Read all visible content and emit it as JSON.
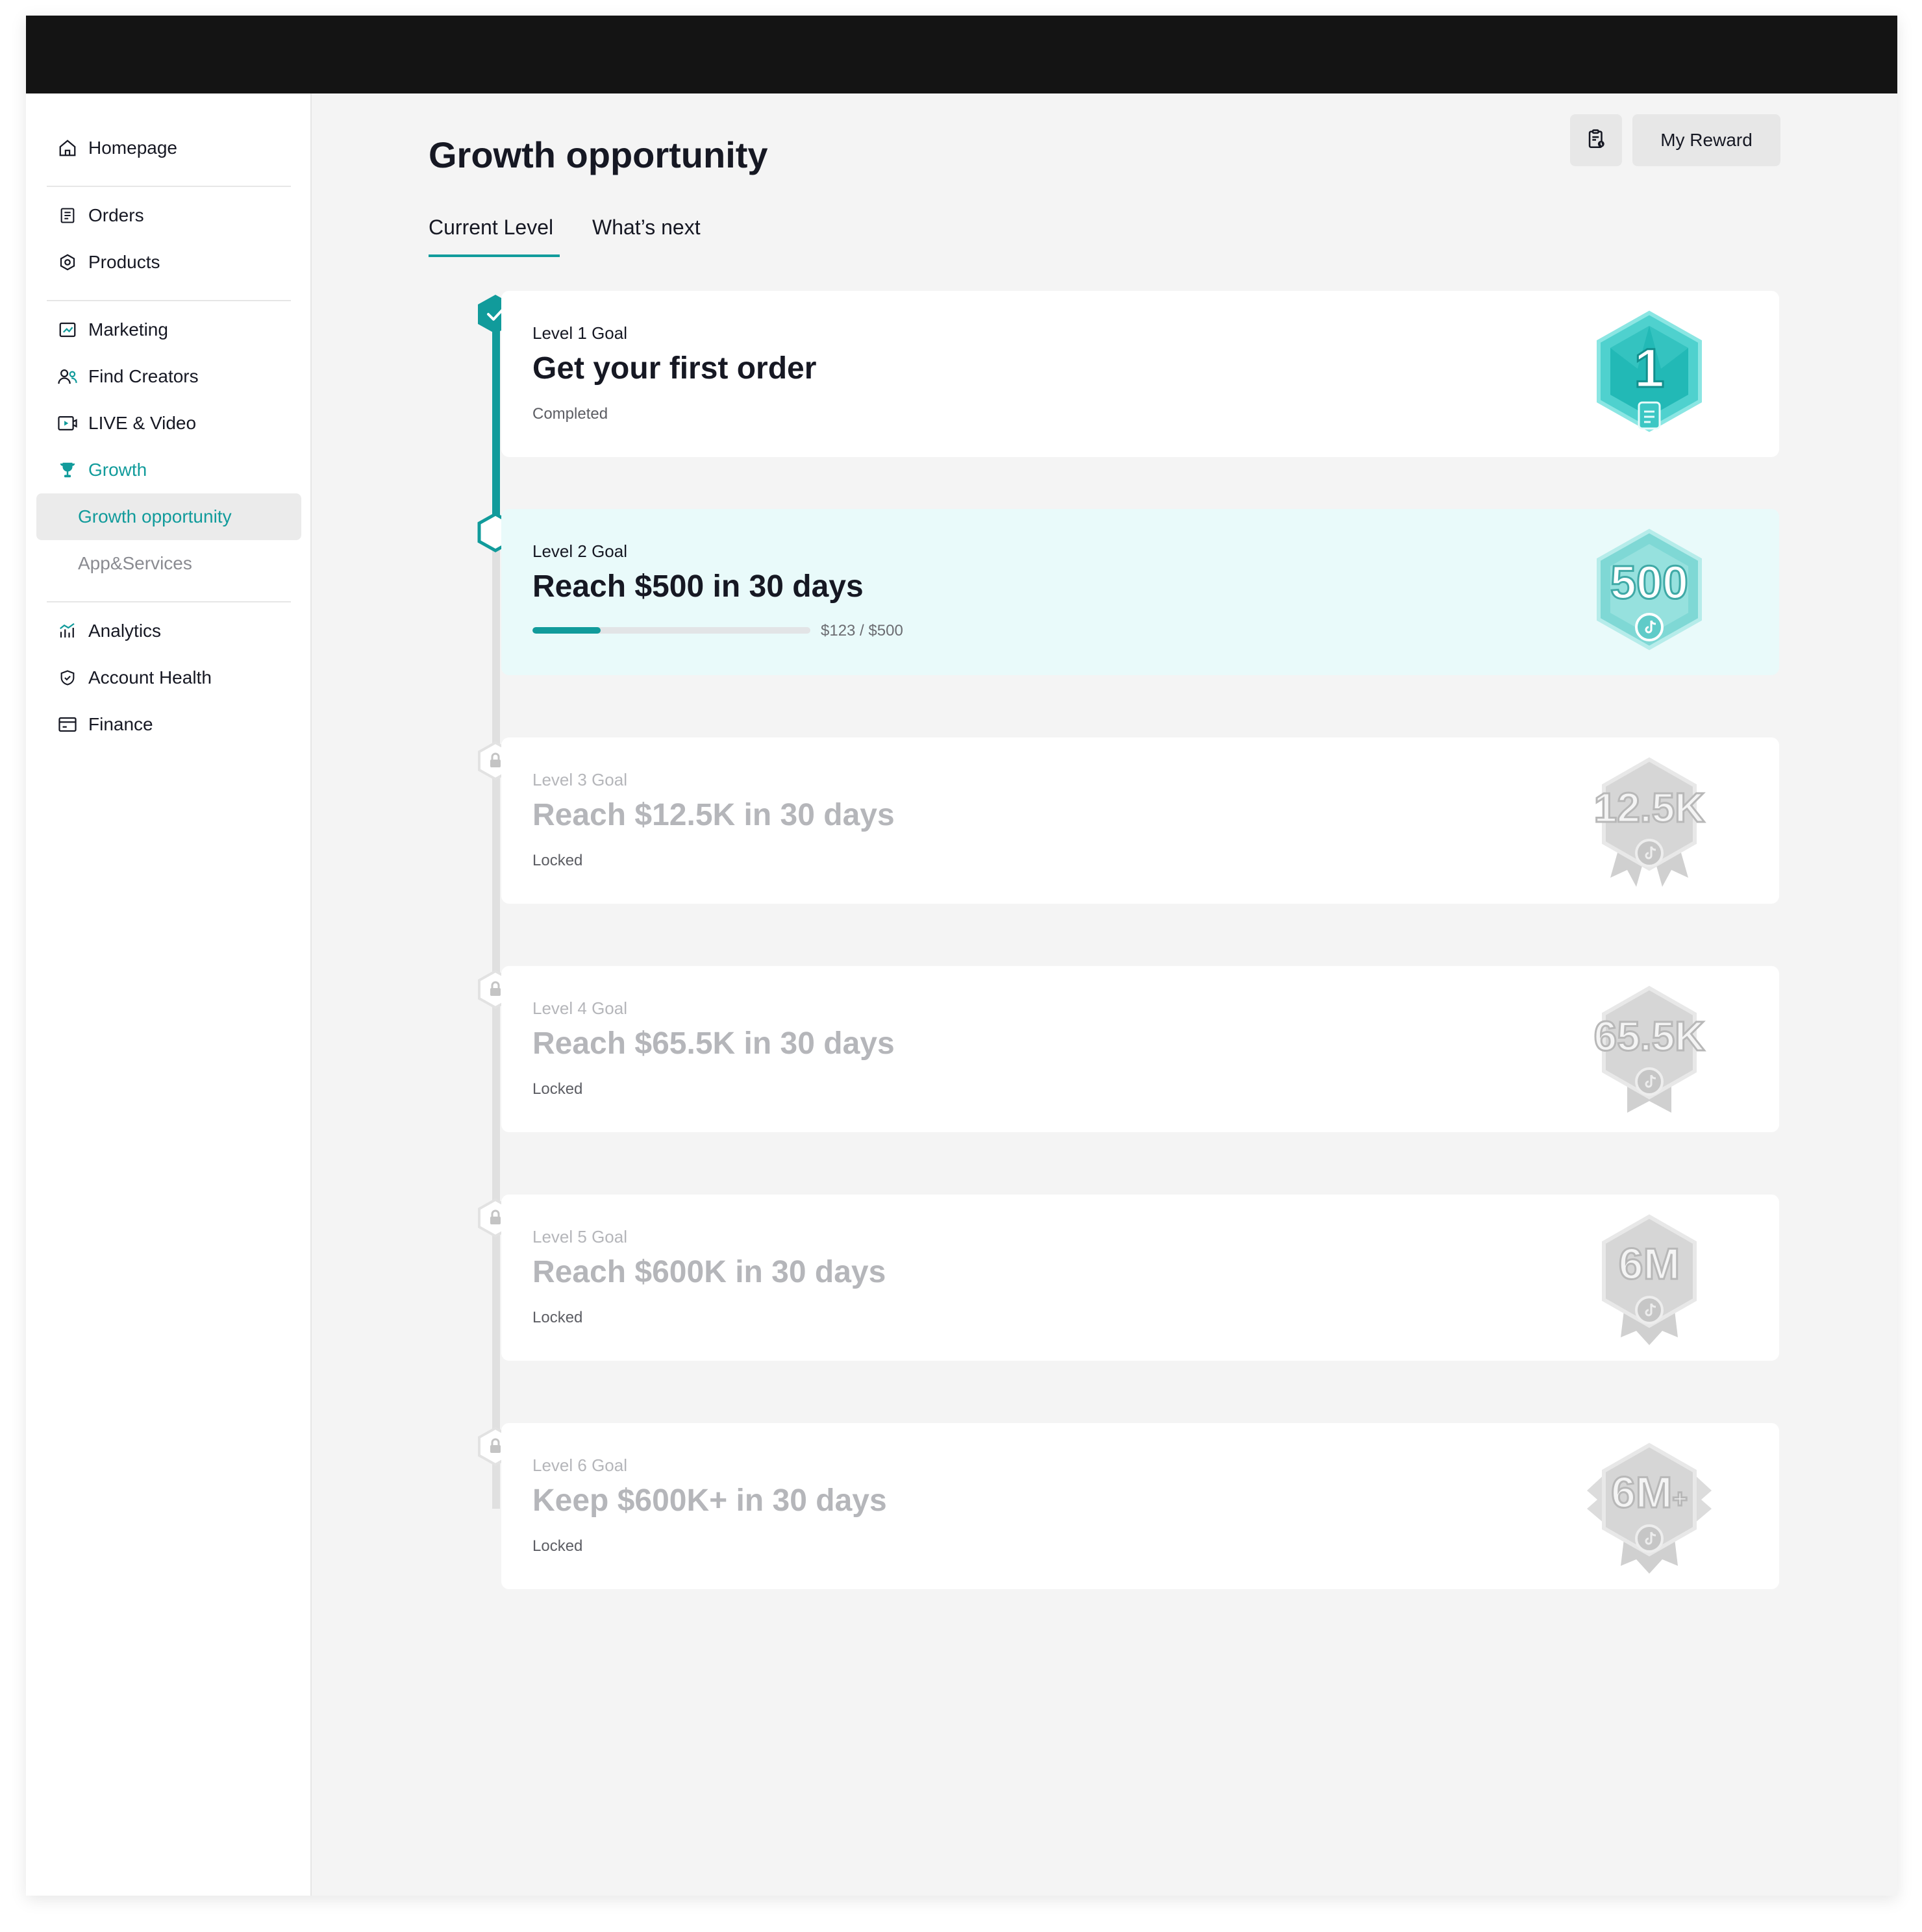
{
  "sidebar": {
    "items": [
      {
        "label": "Homepage",
        "icon": "home-icon"
      },
      {
        "label": "Orders",
        "icon": "orders-icon"
      },
      {
        "label": "Products",
        "icon": "products-icon"
      },
      {
        "label": "Marketing",
        "icon": "marketing-icon"
      },
      {
        "label": "Find Creators",
        "icon": "creators-icon"
      },
      {
        "label": "LIVE & Video",
        "icon": "live-video-icon"
      },
      {
        "label": "Growth",
        "icon": "trophy-icon",
        "expanded": true
      },
      {
        "label": "Growth opportunity",
        "selected": true
      },
      {
        "label": "App&Services"
      },
      {
        "label": "Analytics",
        "icon": "analytics-icon"
      },
      {
        "label": "Account Health",
        "icon": "shield-icon"
      },
      {
        "label": "Finance",
        "icon": "finance-icon"
      }
    ]
  },
  "header": {
    "title": "Growth opportunity",
    "icon_button": "clipboard-icon",
    "reward_label": "My Reward"
  },
  "tabs": [
    {
      "label": "Current Level",
      "active": true
    },
    {
      "label": "What’s next"
    }
  ],
  "levels": [
    {
      "level_label": "Level 1 Goal",
      "title": "Get your first order",
      "status": "Completed",
      "badge": "1",
      "state": "completed"
    },
    {
      "level_label": "Level 2 Goal",
      "title": "Reach $500 in 30 days",
      "progress_text": "$123 / $500",
      "progress": 0.246,
      "badge": "500",
      "state": "current"
    },
    {
      "level_label": "Level 3 Goal",
      "title": "Reach $12.5K in 30 days",
      "status": "Locked",
      "badge": "12.5K",
      "state": "locked"
    },
    {
      "level_label": "Level 4 Goal",
      "title": "Reach $65.5K in 30 days",
      "status": "Locked",
      "badge": "65.5K",
      "state": "locked"
    },
    {
      "level_label": "Level 5 Goal",
      "title": "Reach $600K in 30 days",
      "status": "Locked",
      "badge": "6M",
      "state": "locked"
    },
    {
      "level_label": "Level 6 Goal",
      "title": "Keep $600K+ in 30 days",
      "status": "Locked",
      "badge": "6M",
      "badge_suffix": "+",
      "state": "locked"
    }
  ],
  "colors": {
    "accent": "#119b9b",
    "topbar": "#141414",
    "current_card": "#e9fafa",
    "locked_text": "#b5b6ba"
  }
}
